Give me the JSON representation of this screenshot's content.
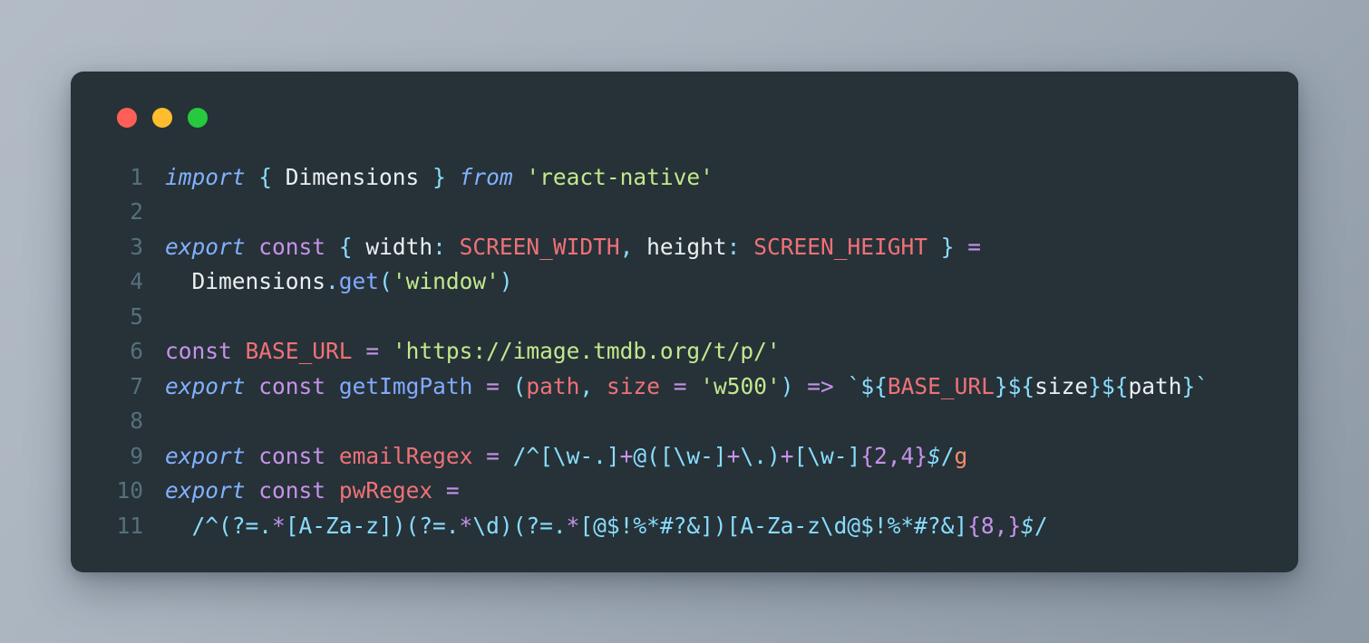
{
  "window": {
    "traffic_lights": [
      {
        "name": "close",
        "color": "#ff5f56"
      },
      {
        "name": "minimize",
        "color": "#ffbd2e"
      },
      {
        "name": "maximize",
        "color": "#27c93f"
      }
    ]
  },
  "editor": {
    "language": "javascript",
    "background": "#263238",
    "page_background": "#aab4bf",
    "line_number_color": "#55707c",
    "line_numbers": [
      "1",
      "2",
      "3",
      "4",
      "5",
      "6",
      "7",
      "8",
      "9",
      "10",
      "11"
    ],
    "lines": [
      {
        "number": "1",
        "text": "import { Dimensions } from 'react-native'",
        "tokens": [
          {
            "t": "import",
            "c": "t-kw"
          },
          {
            "t": " ",
            "c": "t-plain"
          },
          {
            "t": "{",
            "c": "t-punct"
          },
          {
            "t": " Dimensions ",
            "c": "t-plain"
          },
          {
            "t": "}",
            "c": "t-punct"
          },
          {
            "t": " ",
            "c": "t-plain"
          },
          {
            "t": "from",
            "c": "t-kw"
          },
          {
            "t": " ",
            "c": "t-plain"
          },
          {
            "t": "'react-native'",
            "c": "t-str"
          }
        ]
      },
      {
        "number": "2",
        "text": "",
        "tokens": []
      },
      {
        "number": "3",
        "text": "export const { width: SCREEN_WIDTH, height: SCREEN_HEIGHT } =",
        "tokens": [
          {
            "t": "export",
            "c": "t-kw"
          },
          {
            "t": " ",
            "c": "t-plain"
          },
          {
            "t": "const",
            "c": "t-const"
          },
          {
            "t": " ",
            "c": "t-plain"
          },
          {
            "t": "{",
            "c": "t-punct"
          },
          {
            "t": " width",
            "c": "t-plain"
          },
          {
            "t": ":",
            "c": "t-punct"
          },
          {
            "t": " ",
            "c": "t-plain"
          },
          {
            "t": "SCREEN_WIDTH",
            "c": "t-var"
          },
          {
            "t": ",",
            "c": "t-punct"
          },
          {
            "t": " height",
            "c": "t-plain"
          },
          {
            "t": ":",
            "c": "t-punct"
          },
          {
            "t": " ",
            "c": "t-plain"
          },
          {
            "t": "SCREEN_HEIGHT",
            "c": "t-var"
          },
          {
            "t": " ",
            "c": "t-plain"
          },
          {
            "t": "}",
            "c": "t-punct"
          },
          {
            "t": " ",
            "c": "t-plain"
          },
          {
            "t": "=",
            "c": "t-op"
          }
        ]
      },
      {
        "number": "4",
        "text": "  Dimensions.get('window')",
        "tokens": [
          {
            "t": "  Dimensions",
            "c": "t-plain"
          },
          {
            "t": ".",
            "c": "t-punct"
          },
          {
            "t": "get",
            "c": "t-fn"
          },
          {
            "t": "(",
            "c": "t-punct"
          },
          {
            "t": "'window'",
            "c": "t-str"
          },
          {
            "t": ")",
            "c": "t-punct"
          }
        ]
      },
      {
        "number": "5",
        "text": "",
        "tokens": []
      },
      {
        "number": "6",
        "text": "const BASE_URL = 'https://image.tmdb.org/t/p/'",
        "tokens": [
          {
            "t": "const",
            "c": "t-const"
          },
          {
            "t": " ",
            "c": "t-plain"
          },
          {
            "t": "BASE_URL",
            "c": "t-var"
          },
          {
            "t": " ",
            "c": "t-plain"
          },
          {
            "t": "=",
            "c": "t-op"
          },
          {
            "t": " ",
            "c": "t-plain"
          },
          {
            "t": "'https://image.tmdb.org/t/p/'",
            "c": "t-str"
          }
        ]
      },
      {
        "number": "7",
        "text": "export const getImgPath = (path, size = 'w500') => `${BASE_URL}${size}${path}`",
        "tokens": [
          {
            "t": "export",
            "c": "t-kw"
          },
          {
            "t": " ",
            "c": "t-plain"
          },
          {
            "t": "const",
            "c": "t-const"
          },
          {
            "t": " ",
            "c": "t-plain"
          },
          {
            "t": "getImgPath",
            "c": "t-fn"
          },
          {
            "t": " ",
            "c": "t-plain"
          },
          {
            "t": "=",
            "c": "t-op"
          },
          {
            "t": " ",
            "c": "t-plain"
          },
          {
            "t": "(",
            "c": "t-punct"
          },
          {
            "t": "path",
            "c": "t-var"
          },
          {
            "t": ",",
            "c": "t-punct"
          },
          {
            "t": " ",
            "c": "t-plain"
          },
          {
            "t": "size",
            "c": "t-var"
          },
          {
            "t": " ",
            "c": "t-plain"
          },
          {
            "t": "=",
            "c": "t-op"
          },
          {
            "t": " ",
            "c": "t-plain"
          },
          {
            "t": "'w500'",
            "c": "t-str"
          },
          {
            "t": ")",
            "c": "t-punct"
          },
          {
            "t": " ",
            "c": "t-plain"
          },
          {
            "t": "=>",
            "c": "t-op"
          },
          {
            "t": " ",
            "c": "t-plain"
          },
          {
            "t": "`",
            "c": "t-punct"
          },
          {
            "t": "${",
            "c": "t-punct"
          },
          {
            "t": "BASE_URL",
            "c": "t-var"
          },
          {
            "t": "}",
            "c": "t-punct"
          },
          {
            "t": "${",
            "c": "t-punct"
          },
          {
            "t": "size",
            "c": "t-plain"
          },
          {
            "t": "}",
            "c": "t-punct"
          },
          {
            "t": "${",
            "c": "t-punct"
          },
          {
            "t": "path",
            "c": "t-plain"
          },
          {
            "t": "}",
            "c": "t-punct"
          },
          {
            "t": "`",
            "c": "t-punct"
          }
        ]
      },
      {
        "number": "8",
        "text": "",
        "tokens": []
      },
      {
        "number": "9",
        "text": "export const emailRegex = /^[\\w-.]+@([\\w-]+\\.)+[\\w-]{2,4}$/g",
        "tokens": [
          {
            "t": "export",
            "c": "t-kw"
          },
          {
            "t": " ",
            "c": "t-plain"
          },
          {
            "t": "const",
            "c": "t-const"
          },
          {
            "t": " ",
            "c": "t-plain"
          },
          {
            "t": "emailRegex",
            "c": "t-var"
          },
          {
            "t": " ",
            "c": "t-plain"
          },
          {
            "t": "=",
            "c": "t-op"
          },
          {
            "t": " ",
            "c": "t-plain"
          },
          {
            "t": "/^[\\w-.]",
            "c": "t-regex"
          },
          {
            "t": "+",
            "c": "t-op"
          },
          {
            "t": "@([\\w-]",
            "c": "t-regex"
          },
          {
            "t": "+",
            "c": "t-op"
          },
          {
            "t": "\\.)",
            "c": "t-regex"
          },
          {
            "t": "+",
            "c": "t-op"
          },
          {
            "t": "[\\w-]",
            "c": "t-regex"
          },
          {
            "t": "{2,4}",
            "c": "t-op"
          },
          {
            "t": "$",
            "c": "t-anchor"
          },
          {
            "t": "/",
            "c": "t-regex"
          },
          {
            "t": "g",
            "c": "t-flag"
          }
        ]
      },
      {
        "number": "10",
        "text": "export const pwRegex =",
        "tokens": [
          {
            "t": "export",
            "c": "t-kw"
          },
          {
            "t": " ",
            "c": "t-plain"
          },
          {
            "t": "const",
            "c": "t-const"
          },
          {
            "t": " ",
            "c": "t-plain"
          },
          {
            "t": "pwRegex",
            "c": "t-var"
          },
          {
            "t": " ",
            "c": "t-plain"
          },
          {
            "t": "=",
            "c": "t-op"
          }
        ]
      },
      {
        "number": "11",
        "text": "  /^(?=.*[A-Za-z])(?=.*\\d)(?=.*[@$!%*#?&])[A-Za-z\\d@$!%*#?&]{8,}$/",
        "tokens": [
          {
            "t": "  /^(?=.",
            "c": "t-regex"
          },
          {
            "t": "*",
            "c": "t-op"
          },
          {
            "t": "[A-Za-z])(?=.",
            "c": "t-regex"
          },
          {
            "t": "*",
            "c": "t-op"
          },
          {
            "t": "\\d)(?=.",
            "c": "t-regex"
          },
          {
            "t": "*",
            "c": "t-op"
          },
          {
            "t": "[@$!%*#?&])[A-Za-z\\d@$!%*#?&]",
            "c": "t-regex"
          },
          {
            "t": "{8,}",
            "c": "t-op"
          },
          {
            "t": "$",
            "c": "t-anchor"
          },
          {
            "t": "/",
            "c": "t-regex"
          }
        ]
      }
    ]
  }
}
